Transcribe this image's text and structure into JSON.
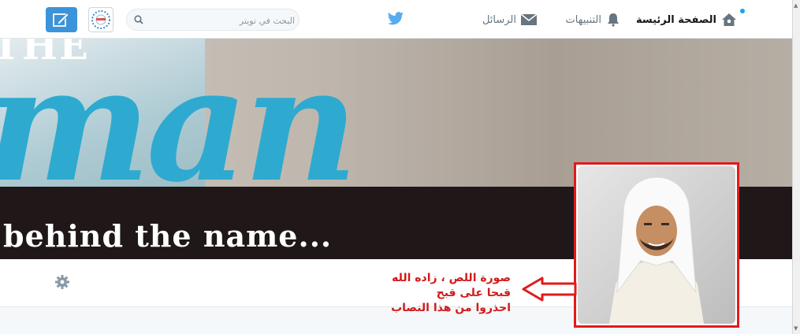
{
  "nav": {
    "home_label": "الصفحة الرئيسة",
    "notifications_label": "التنبيهات",
    "messages_label": "الرسائل",
    "search_placeholder": "البحث في تويتر"
  },
  "banner": {
    "line1": "THE",
    "line2": "man",
    "line3": "behind the name..."
  },
  "annotation": {
    "line1": "صورة اللص ، زاده الله قبحا على قبح",
    "line2": "احذروا من هذا النصاب"
  },
  "colors": {
    "accent": "#1da1f2",
    "tweet_button": "#3b94d9",
    "annotation_red": "#e01b1b"
  },
  "icons": {
    "home": "home-icon",
    "notifications": "bell-icon",
    "messages": "envelope-icon",
    "logo": "twitter-bird-icon",
    "search": "search-icon",
    "tweet": "compose-icon",
    "settings": "gear-icon"
  }
}
